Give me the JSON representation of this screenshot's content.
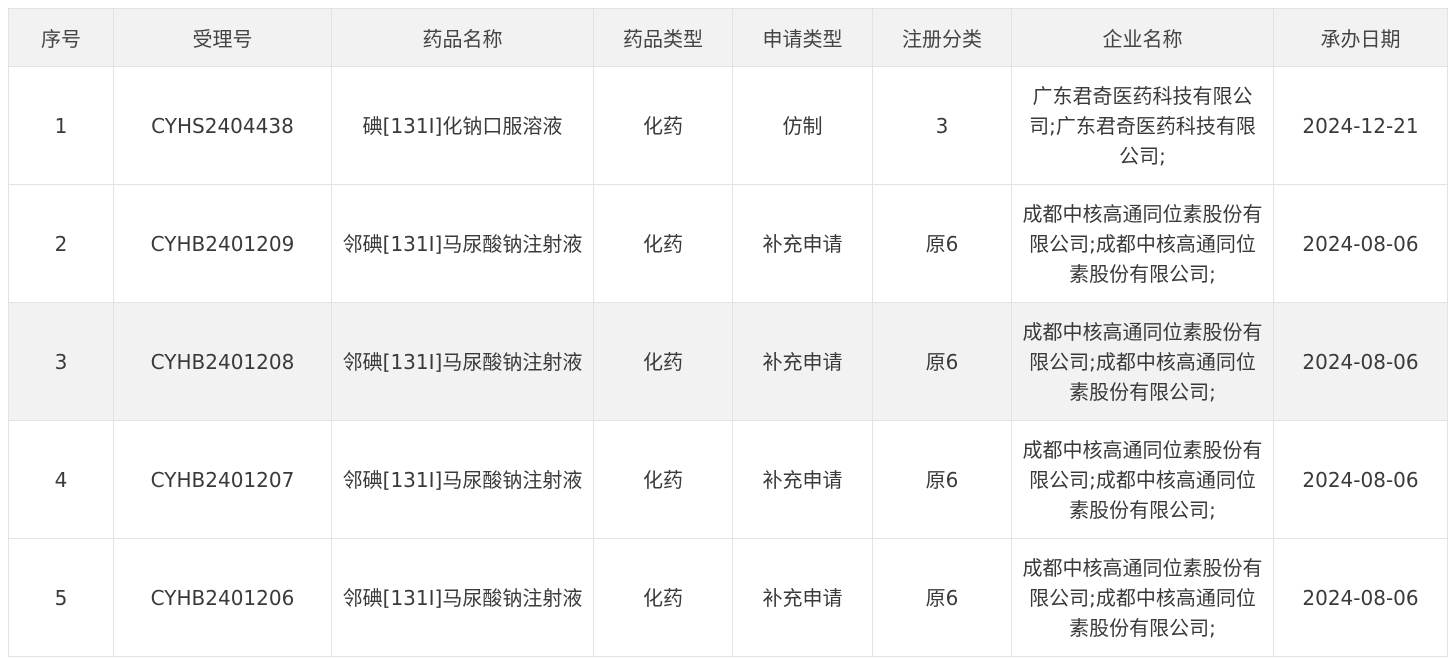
{
  "table": {
    "headers": [
      "序号",
      "受理号",
      "药品名称",
      "药品类型",
      "申请类型",
      "注册分类",
      "企业名称",
      "承办日期"
    ],
    "rows": [
      {
        "index": "1",
        "acceptance_no": "CYHS2404438",
        "drug_name": "碘[131I]化钠口服溶液",
        "drug_type": "化药",
        "application_type": "仿制",
        "registration_class": "3",
        "company": "广东君奇医药科技有限公司;广东君奇医药科技有限公司;",
        "date": "2024-12-21"
      },
      {
        "index": "2",
        "acceptance_no": "CYHB2401209",
        "drug_name": "邻碘[131I]马尿酸钠注射液",
        "drug_type": "化药",
        "application_type": "补充申请",
        "registration_class": "原6",
        "company": "成都中核高通同位素股份有限公司;成都中核高通同位素股份有限公司;",
        "date": "2024-08-06"
      },
      {
        "index": "3",
        "acceptance_no": "CYHB2401208",
        "drug_name": "邻碘[131I]马尿酸钠注射液",
        "drug_type": "化药",
        "application_type": "补充申请",
        "registration_class": "原6",
        "company": "成都中核高通同位素股份有限公司;成都中核高通同位素股份有限公司;",
        "date": "2024-08-06"
      },
      {
        "index": "4",
        "acceptance_no": "CYHB2401207",
        "drug_name": "邻碘[131I]马尿酸钠注射液",
        "drug_type": "化药",
        "application_type": "补充申请",
        "registration_class": "原6",
        "company": "成都中核高通同位素股份有限公司;成都中核高通同位素股份有限公司;",
        "date": "2024-08-06"
      },
      {
        "index": "5",
        "acceptance_no": "CYHB2401206",
        "drug_name": "邻碘[131I]马尿酸钠注射液",
        "drug_type": "化药",
        "application_type": "补充申请",
        "registration_class": "原6",
        "company": "成都中核高通同位素股份有限公司;成都中核高通同位素股份有限公司;",
        "date": "2024-08-06"
      }
    ]
  }
}
